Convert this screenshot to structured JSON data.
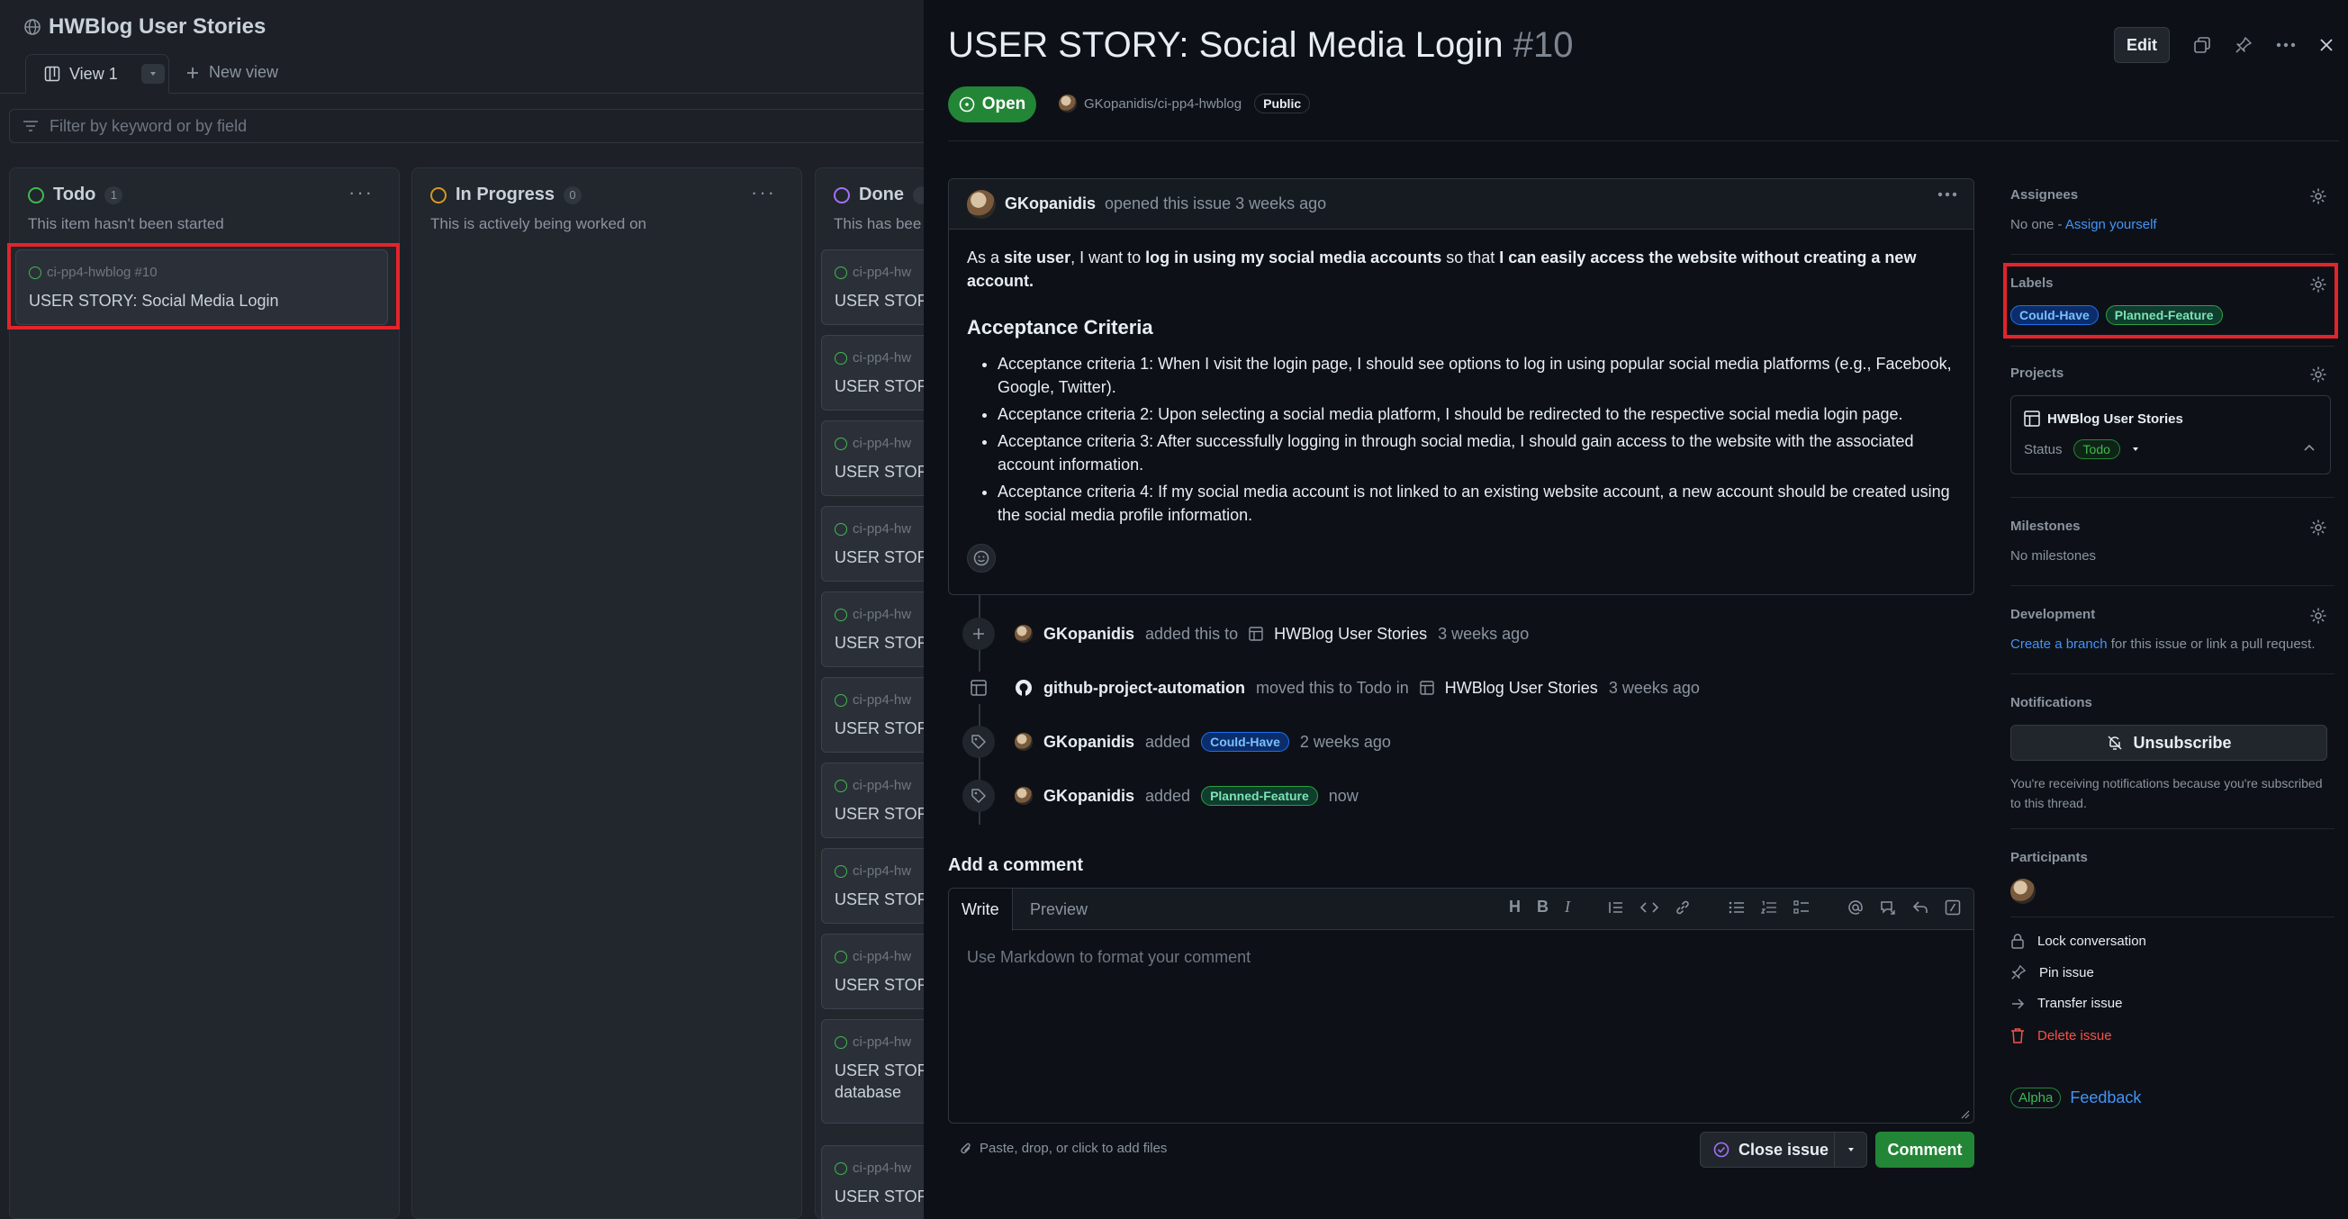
{
  "board": {
    "title": "HWBlog User Stories",
    "view_tab": "View 1",
    "new_view": "New view",
    "filter_placeholder": "Filter by keyword or by field",
    "columns": [
      {
        "name": "Todo",
        "count": "1",
        "desc": "This item hasn't been started",
        "color": "#3fb950"
      },
      {
        "name": "In Progress",
        "count": "0",
        "desc": "This is actively being worked on",
        "color": "#d29922"
      },
      {
        "name": "Done",
        "count": "",
        "desc": "This has bee",
        "color": "#a371f7"
      }
    ],
    "todo_card": {
      "meta": "ci-pp4-hwblog #10",
      "title": "USER STORY: Social Media Login"
    },
    "done_card_meta": "ci-pp4-hw",
    "done_card_title": "USER STORY",
    "done_card_extra": "database"
  },
  "issue": {
    "title": "USER STORY: Social Media Login",
    "number": "#10",
    "state": "Open",
    "repo": "GKopanidis/ci-pp4-hwblog",
    "visibility": "Public",
    "edit_label": "Edit",
    "author": "GKopanidis",
    "opened_text": "opened this issue 3 weeks ago",
    "body": {
      "p1_a": "As a ",
      "p1_b": "site user",
      "p1_c": ", I want to ",
      "p1_d": "log in using my social media accounts",
      "p1_e": " so that ",
      "p1_f": "I can easily access the website without creating a new account.",
      "heading": "Acceptance Criteria",
      "criteria": [
        "Acceptance criteria 1: When I visit the login page, I should see options to log in using popular social media platforms (e.g., Facebook, Google, Twitter).",
        "Acceptance criteria 2: Upon selecting a social media platform, I should be redirected to the respective social media login page.",
        "Acceptance criteria 3: After successfully logging in through social media, I should gain access to the website with the associated account information.",
        "Acceptance criteria 4: If my social media account is not linked to an existing website account, a new account should be created using the social media profile information."
      ]
    },
    "timeline": [
      {
        "actor": "GKopanidis",
        "a": "added this to",
        "target": "HWBlog User Stories",
        "time": "3 weeks ago"
      },
      {
        "actor": "github-project-automation",
        "a": "moved this to Todo in",
        "target": "HWBlog User Stories",
        "time": "3 weeks ago"
      },
      {
        "actor": "GKopanidis",
        "a": "added",
        "label": "Could-Have",
        "time": "2 weeks ago"
      },
      {
        "actor": "GKopanidis",
        "a": "added",
        "label": "Planned-Feature",
        "time": "now"
      }
    ],
    "add_comment": "Add a comment",
    "write_tab": "Write",
    "preview_tab": "Preview",
    "comment_placeholder": "Use Markdown to format your comment",
    "attach_text": "Paste, drop, or click to add files",
    "close_label": "Close issue",
    "comment_label": "Comment"
  },
  "sidebar": {
    "assignees_title": "Assignees",
    "assignees_none": "No one - ",
    "assign_yourself": "Assign yourself",
    "labels_title": "Labels",
    "labels": [
      "Could-Have",
      "Planned-Feature"
    ],
    "projects_title": "Projects",
    "project_name": "HWBlog User Stories",
    "status_label": "Status",
    "status_value": "Todo",
    "milestones_title": "Milestones",
    "milestones_none": "No milestones",
    "development_title": "Development",
    "create_branch": "Create a branch",
    "development_text": " for this issue or link a pull request.",
    "notifications_title": "Notifications",
    "unsubscribe": "Unsubscribe",
    "notify_text": "You're receiving notifications because you're subscribed to this thread.",
    "participants_title": "Participants",
    "lock": "Lock conversation",
    "pin": "Pin issue",
    "transfer": "Transfer issue",
    "delete": "Delete issue",
    "alpha": "Alpha",
    "feedback": "Feedback"
  }
}
